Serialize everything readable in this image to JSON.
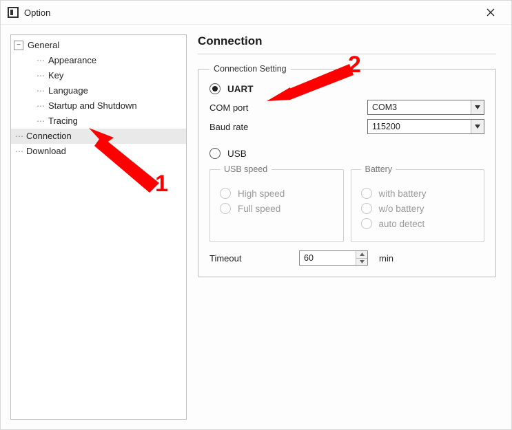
{
  "window": {
    "title": "Option"
  },
  "tree": {
    "general": "General",
    "appearance": "Appearance",
    "key": "Key",
    "language": "Language",
    "startup": "Startup and Shutdown",
    "tracing": "Tracing",
    "connection": "Connection",
    "download": "Download"
  },
  "page": {
    "title": "Connection",
    "group_setting": "Connection Setting",
    "uart_label": "UART",
    "com_port_label": "COM port",
    "com_port_value": "COM3",
    "baud_label": "Baud rate",
    "baud_value": "115200",
    "usb_label": "USB",
    "usb_speed_group": "USB speed",
    "high_speed": "High speed",
    "full_speed": "Full speed",
    "battery_group": "Battery",
    "with_battery": "with battery",
    "wo_battery": "w/o battery",
    "auto_detect": "auto detect",
    "timeout_label": "Timeout",
    "timeout_value": "60",
    "timeout_unit": "min"
  },
  "annotations": {
    "one": "1",
    "two": "2"
  }
}
